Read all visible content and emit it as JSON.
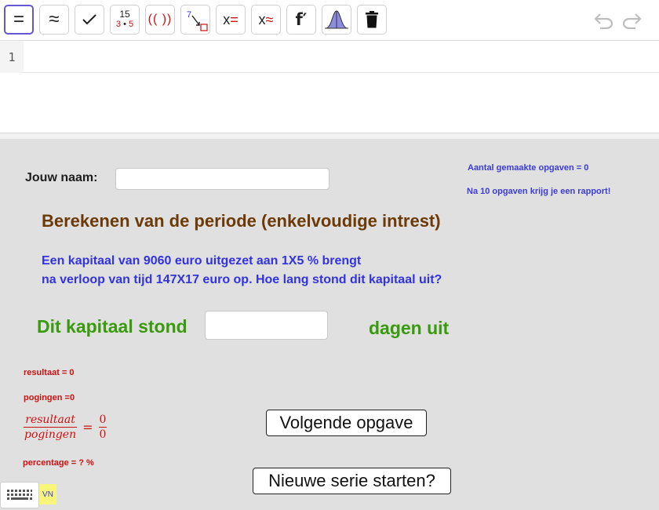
{
  "toolbar": {
    "tools": [
      {
        "name": "equals-tool",
        "label": "="
      },
      {
        "name": "approx-tool",
        "label": "≈"
      },
      {
        "name": "check-tool",
        "label": "✓"
      },
      {
        "name": "factor-tool",
        "top": "15",
        "bottom_a": "3",
        "bottom_b": "5"
      },
      {
        "name": "expand-tool",
        "label": "(( ))"
      },
      {
        "name": "substitute-tool",
        "label": "7"
      },
      {
        "name": "solve-tool",
        "label_x": "x",
        "label_op": "="
      },
      {
        "name": "nsolve-tool",
        "label_x": "x",
        "label_op": "≈"
      },
      {
        "name": "derivative-tool",
        "label": "f′"
      },
      {
        "name": "probability-tool"
      },
      {
        "name": "delete-tool"
      }
    ]
  },
  "algebra": {
    "row_number": "1",
    "input_value": ""
  },
  "form": {
    "name_label": "Jouw naam:",
    "name_value": "",
    "count_text": "Aantal gemaakte opgaven = 0",
    "report_text": "Na 10 opgaven krijg je een rapport!",
    "title": "Berekenen van de periode (enkelvoudige intrest)",
    "question_line1": "Een kapitaal van 9060 euro uitgezet aan 1X5 % brengt",
    "question_line2": "na verloop van tijd 147X17 euro op. Hoe lang stond dit kapitaal uit?",
    "answer_prefix": "Dit kapitaal stond",
    "answer_value": "",
    "answer_suffix": "dagen uit"
  },
  "stats": {
    "resultaat": "resultaat = 0",
    "pogingen": "pogingen =0",
    "frac_num_label": "resultaat",
    "frac_den_label": "pogingen",
    "frac_eq": "=",
    "frac_num_value": "0",
    "frac_den_value": "0",
    "percentage": "percentage = ? %"
  },
  "buttons": {
    "next": "Volgende opgave",
    "new_series": "Nieuwe serie starten?"
  },
  "footer": {
    "lang_badge": "VN"
  },
  "colors": {
    "accent": "#6557d2",
    "title": "#6b3a07",
    "question": "#3333dd",
    "answer": "#3a9a0e",
    "stats": "#cc1111"
  }
}
